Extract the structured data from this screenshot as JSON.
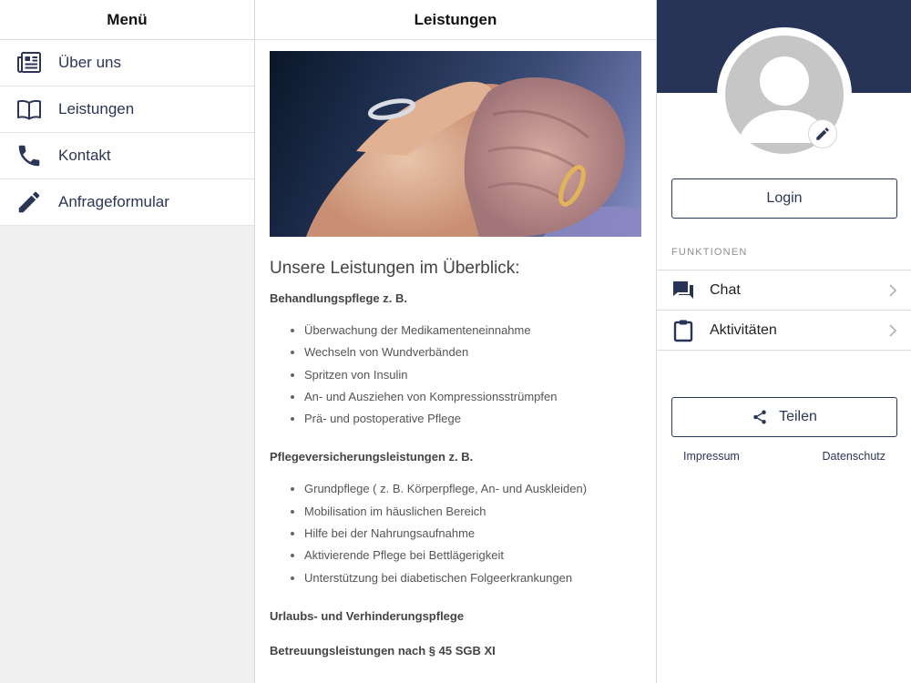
{
  "menu": {
    "title": "Menü",
    "items": [
      {
        "label": "Über uns",
        "icon": "newspaper-icon"
      },
      {
        "label": "Leistungen",
        "icon": "book-icon"
      },
      {
        "label": "Kontakt",
        "icon": "phone-icon"
      },
      {
        "label": "Anfrageformular",
        "icon": "pencil-icon"
      }
    ]
  },
  "content": {
    "title": "Leistungen",
    "heading": "Unsere Leistungen im Überblick:",
    "sections": [
      {
        "heading": "Behandlungspflege z. B.",
        "items": [
          "Überwachung der Medikamenteneinnahme",
          "Wechseln von Wundverbänden",
          "Spritzen von Insulin",
          "An- und Ausziehen von Kompressionsstrümpfen",
          "Prä- und postoperative Pflege"
        ]
      },
      {
        "heading": "Pflegeversicherungsleistungen z. B.",
        "items": [
          "Grundpflege ( z. B. Körperpflege, An- und Auskleiden)",
          "Mobilisation im häuslichen Bereich",
          "Hilfe bei der Nahrungsaufnahme",
          "Aktivierende Pflege bei Bettlägerigkeit",
          "Unterstützung bei diabetischen Folgeerkrankungen"
        ]
      },
      {
        "heading": "Urlaubs- und Verhinderungspflege",
        "items": []
      },
      {
        "heading": "Betreuungsleistungen nach § 45 SGB XI",
        "items": []
      }
    ]
  },
  "profile": {
    "login_label": "Login",
    "functions_label": "FUNKTIONEN",
    "functions": [
      {
        "label": "Chat",
        "icon": "chat-icon"
      },
      {
        "label": "Aktivitäten",
        "icon": "clipboard-icon"
      }
    ],
    "share_label": "Teilen",
    "footer": {
      "impressum": "Impressum",
      "datenschutz": "Datenschutz"
    }
  },
  "colors": {
    "brand_navy": "#283457",
    "link_navy": "#2c3656",
    "menu_background": "#f0f0f1",
    "avatar_gray": "#c6c6c6"
  }
}
